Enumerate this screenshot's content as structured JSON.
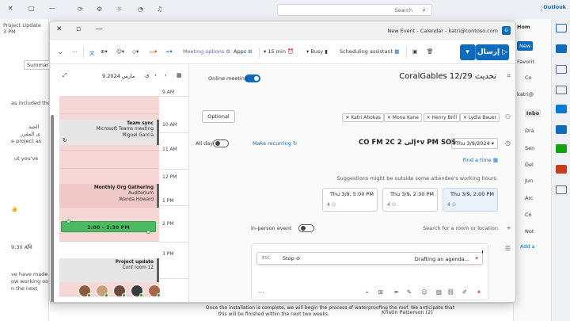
{
  "background": {
    "search_label": "Search",
    "app_name": "Outlook",
    "left_items": [
      "Project Update",
      "3 PM",
      "Summarize",
      "as included the",
      "الجيد",
      "ى المقرر",
      "e project as",
      "ut you've",
      "9:30 AM",
      "ve have made",
      "ow working on",
      "n the next"
    ],
    "folders": [
      "Hom",
      "New",
      "Favorit",
      "Co",
      "katri@",
      "Inbo",
      "Dra",
      "Sen",
      "Del",
      "Jun",
      "Arc",
      "Co",
      "Not",
      "Add a"
    ],
    "bottom_texts": [
      "Once the installation is complete, we will begin the process of waterproofing the roof. We anticipate that",
      "this will be finished within the next two weeks.",
      "Kristin Patterson (2)"
    ]
  },
  "window": {
    "title": "New Event - Calendar - katri@contoso.com"
  },
  "toolbar": {
    "send": "إرسال",
    "scheduling": "Scheduling assistant",
    "busy": "Busy",
    "reminder": "15 min",
    "meeting_options": "Meeting options",
    "apps": "Apps"
  },
  "calendar": {
    "date_label": "9.2024 مارس",
    "prev_label": "‹",
    "next_label": "›",
    "day_label": "ي",
    "times": [
      "9 AM",
      "10 AM",
      "11 AM",
      "12 PM",
      "1 PM",
      "2 PM",
      "3 PM"
    ],
    "events": [
      {
        "title": "Team sync",
        "line2": "Microsoft Teams meeting",
        "line3": "Miguel Garcia"
      },
      {
        "title": "Monthly Org Gathering",
        "line2": "Auditorium",
        "line3": "Wanda Howard"
      },
      {
        "title": "Project update",
        "line2": "Conf room 12",
        "line3": ""
      }
    ],
    "selected": "2:00 – 2:30 PM"
  },
  "form": {
    "title": "CoralGables 12/29 تحديث",
    "online_meeting": "Online meeting",
    "optional": "Optional",
    "attendees": [
      "Lydia Bauer",
      "Henry Brill",
      "Mona Kane",
      "Katri Ahokas"
    ],
    "date": "Thu 3/9/2024",
    "start": "2:00 PM",
    "end": "2:30 PM",
    "title_display": "CO FM 2C إلى 2•v PM SO$",
    "all_day": "All day",
    "make_recurring": "Make recurring",
    "find_time": "Find a time",
    "suggestion_note": "Suggestions might be outside some attendee's working hours.",
    "suggestions": [
      {
        "time": "Thu 3/9, 2:00 PM",
        "count": "4"
      },
      {
        "time": "Thu 3/9, 2:30 PM",
        "count": "4"
      },
      {
        "time": "Thu 3/9, 5:00 PM",
        "count": "4"
      }
    ],
    "location": "Search for a room or location",
    "in_person": "In-person event",
    "agenda": "Drafting an agenda...",
    "stop": "Stop",
    "esc": "ESC"
  }
}
